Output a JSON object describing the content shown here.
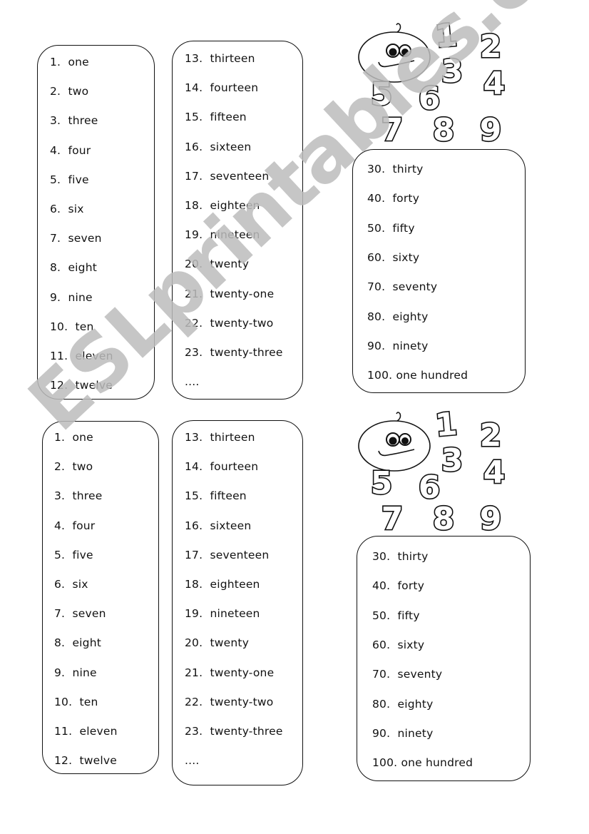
{
  "watermark": "ESLprintables.com",
  "set_top": {
    "col1": [
      "1.  one",
      "2.  two",
      "3.  three",
      "4.  four",
      "5.  five",
      "6.  six",
      "7.  seven",
      "8.  eight",
      "9.  nine",
      "10.  ten",
      "11.  eleven",
      "12.  twelve"
    ],
    "col2": [
      "13.  thirteen",
      "14.  fourteen",
      "15.  fifteen",
      "16.  sixteen",
      "17.  seventeen",
      "18.  eighteen",
      "19.  nineteen",
      "20.  twenty",
      "21.  twenty-one",
      "22.  twenty-two",
      "23.  twenty-three",
      "...."
    ],
    "col3": [
      "30.  thirty",
      "40.  forty",
      "50.  fifty",
      "60.  sixty",
      "70.  seventy",
      "80.  eighty",
      "90.  ninety",
      "100. one hundred"
    ],
    "art_digits": [
      "1",
      "2",
      "3",
      "4",
      "5",
      "6",
      "7",
      "8",
      "9"
    ]
  },
  "set_bottom": {
    "col1": [
      "1.  one",
      "2.  two",
      "3.  three",
      "4.  four",
      "5.  five",
      "6.  six",
      "7.  seven",
      "8.  eight",
      "9.  nine",
      "10.  ten",
      "11.  eleven",
      "12.  twelve"
    ],
    "col2": [
      "13.  thirteen",
      "14.  fourteen",
      "15.  fifteen",
      "16.  sixteen",
      "17.  seventeen",
      "18.  eighteen",
      "19.  nineteen",
      "20.  twenty",
      "21.  twenty-one",
      "22.  twenty-two",
      "23.  twenty-three",
      "...."
    ],
    "col3": [
      "30.  thirty",
      "40.  forty",
      "50.  fifty",
      "60.  sixty",
      "70.  seventy",
      "80.  eighty",
      "90.  ninety",
      "100. one hundred"
    ],
    "art_digits": [
      "1",
      "2",
      "3",
      "4",
      "5",
      "6",
      "7",
      "8",
      "9"
    ]
  }
}
